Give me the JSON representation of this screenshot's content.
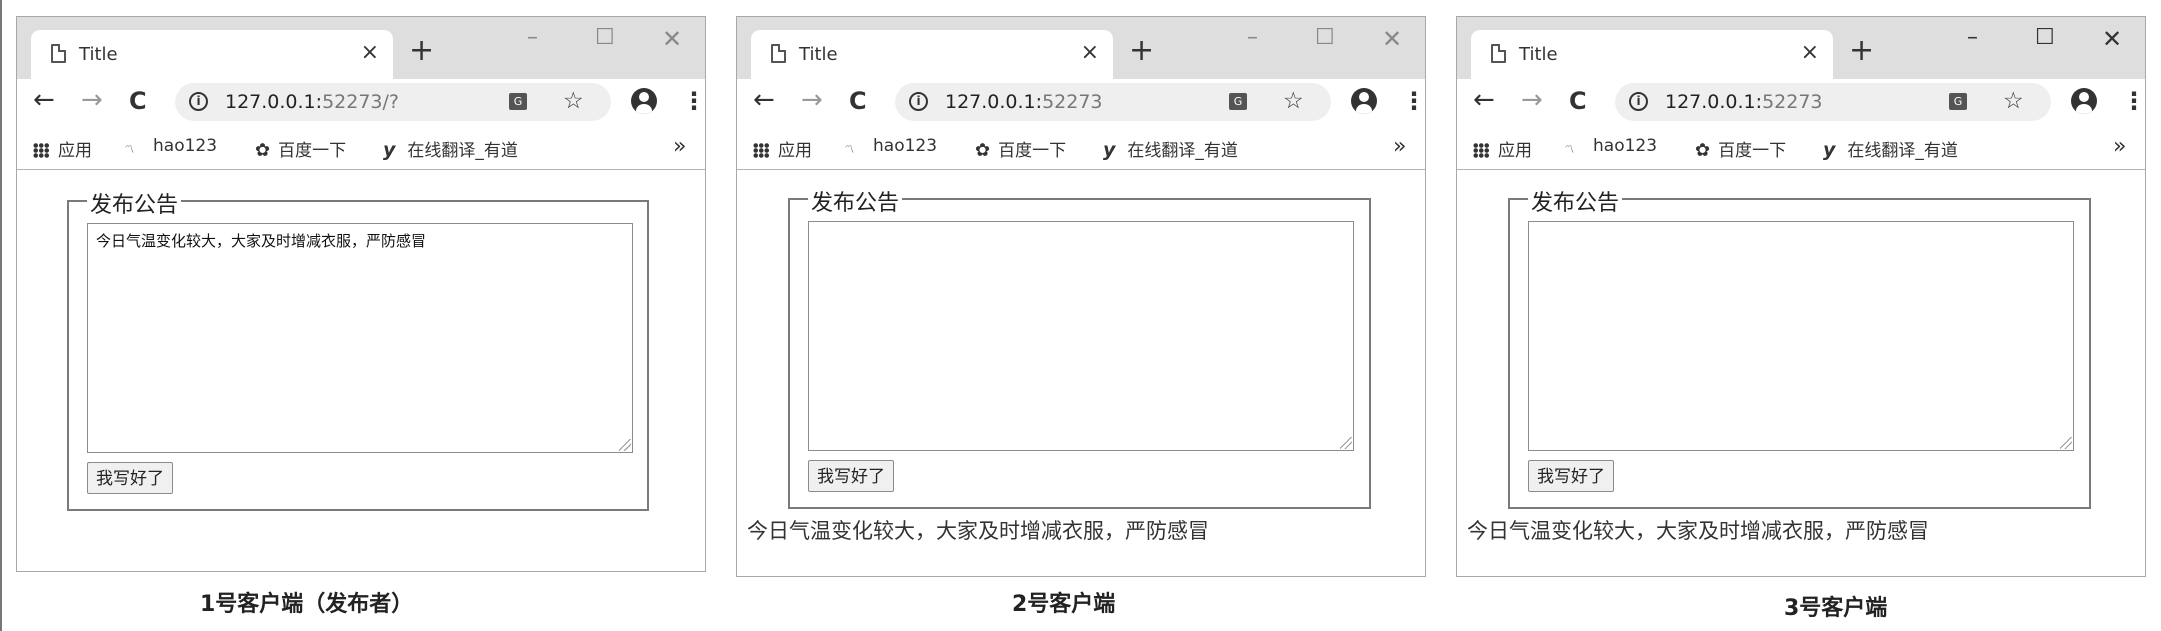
{
  "windows": [
    {
      "tab_title": "Title",
      "url_host": "127.0.0.1:",
      "url_rest": "52273/?",
      "bookmarks": {
        "apps": "应用",
        "hao123": "hao123",
        "baidu": "百度一下",
        "youdao": "在线翻译_有道",
        "more": "»"
      },
      "legend": "发布公告",
      "textarea_value": "今日气温变化较大，大家及时增减衣服，严防感冒",
      "submit_label": "我写好了",
      "announcement": ""
    },
    {
      "tab_title": "Title",
      "url_host": "127.0.0.1:",
      "url_rest": "52273",
      "bookmarks": {
        "apps": "应用",
        "hao123": "hao123",
        "baidu": "百度一下",
        "youdao": "在线翻译_有道",
        "more": "»"
      },
      "legend": "发布公告",
      "textarea_value": "",
      "submit_label": "我写好了",
      "announcement": "今日气温变化较大，大家及时增减衣服，严防感冒"
    },
    {
      "tab_title": "Title",
      "url_host": "127.0.0.1:",
      "url_rest": "52273",
      "bookmarks": {
        "apps": "应用",
        "hao123": "hao123",
        "baidu": "百度一下",
        "youdao": "在线翻译_有道",
        "more": "»"
      },
      "legend": "发布公告",
      "textarea_value": "",
      "submit_label": "我写好了",
      "announcement": "今日气温变化较大，大家及时增减衣服，严防感冒"
    }
  ],
  "captions": [
    "1号客户端（发布者）",
    "2号客户端",
    "3号客户端"
  ],
  "icons": {
    "tab_close": "×",
    "new_tab": "+",
    "minimize": "–",
    "maximize": "☐",
    "close": "✕",
    "back": "←",
    "forward": "→",
    "reload": "C",
    "info": "i",
    "translate": "G",
    "star": "☆",
    "menu": "⋮"
  }
}
